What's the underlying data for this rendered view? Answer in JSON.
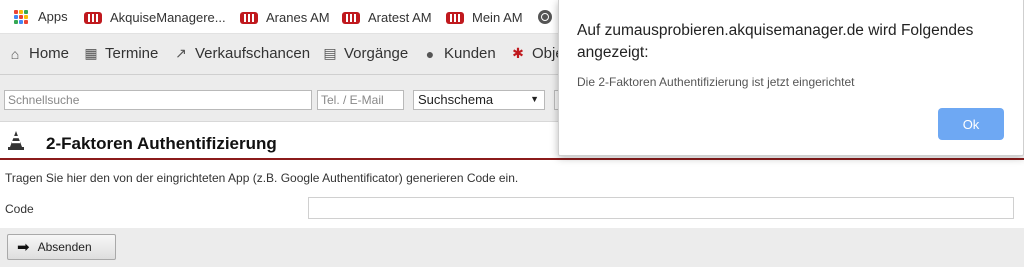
{
  "bookmarks": {
    "items": [
      {
        "label": "Apps"
      },
      {
        "label": "AkquiseManagere..."
      },
      {
        "label": "Aranes AM"
      },
      {
        "label": "Aratest AM"
      },
      {
        "label": "Mein AM"
      }
    ],
    "colors": {
      "am_logo": "#c0191e"
    }
  },
  "nav": {
    "items": [
      {
        "label": "Home",
        "icon": "home-icon"
      },
      {
        "label": "Termine",
        "icon": "calendar-icon"
      },
      {
        "label": "Verkaufschancen",
        "icon": "chart-line-icon"
      },
      {
        "label": "Vorgänge",
        "icon": "clipboard-icon"
      },
      {
        "label": "Kunden",
        "icon": "users-icon"
      },
      {
        "label": "Obje",
        "icon": "objects-icon"
      }
    ]
  },
  "search": {
    "quick_placeholder": "Schnellsuche",
    "phone_placeholder": "Tel. / E-Mail",
    "schema_value": "Suchschema"
  },
  "page": {
    "title": "2-Faktoren Authentifizierung",
    "description": "Tragen Sie hier den von der eingrichteten App (z.B. Google Authentificator) generieren Code ein.",
    "code_label": "Code",
    "submit_label": "Absenden",
    "accent_color": "#8b1b1b"
  },
  "dialog": {
    "title": "Auf zumausprobieren.akquisemanager.de wird Folgendes angezeigt:",
    "message": "Die 2-Faktoren Authentifizierung ist jetzt eingerichtet",
    "ok_label": "Ok",
    "ok_color": "#6ea8f3"
  }
}
